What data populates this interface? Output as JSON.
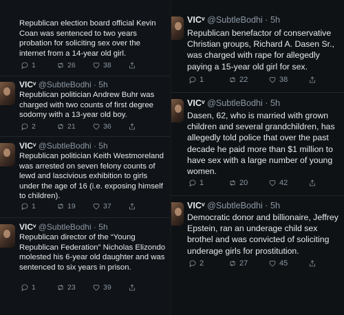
{
  "left": [
    {
      "author": "",
      "handle": "",
      "text": "Republican election board official Kevin Coan was sentenced to two years probation for soliciting sex over the internet from a 14-year old girl.",
      "replies": "1",
      "retweets": "26",
      "likes": "38"
    },
    {
      "author": "VICᵛ",
      "handle": "@SubtleBodhi · 5h",
      "text": "Republican politician Andrew Buhr was charged with two counts of first degree sodomy with a 13-year old boy.",
      "replies": "2",
      "retweets": "21",
      "likes": "36"
    },
    {
      "author": "VICᵛ",
      "handle": "@SubtleBodhi · 5h",
      "text": "Republican politician Keith Westmoreland was arrested on seven felony counts of lewd and lascivious exhibition to girls under the age of 16 (i.e. exposing himself to children).",
      "replies": "1",
      "retweets": "19",
      "likes": "37"
    },
    {
      "author": "VICᵛ",
      "handle": "@SubtleBodhi · 5h",
      "text": "Republican director of the “Young Republican Federation” Nicholas Elizondo molested his 6-year old daughter and was sentenced to six years in prison.",
      "replies": "1",
      "retweets": "23",
      "likes": "39"
    }
  ],
  "right": [
    {
      "author": "VICᵛ",
      "handle": "@SubtleBodhi · 5h",
      "text": "Republican benefactor of conservative Christian groups, Richard A. Dasen Sr., was charged with rape for allegedly paying a 15-year old girl for sex.",
      "replies": "1",
      "retweets": "22",
      "likes": "38"
    },
    {
      "author": "VICᵛ",
      "handle": "@SubtleBodhi · 5h",
      "text": "Dasen, 62, who is married with grown children and several grandchildren, has allegedly told police that over the past decade he paid more than $1 million to have sex with a large number of young women.",
      "replies": "1",
      "retweets": "20",
      "likes": "42"
    },
    {
      "author": "VICᵛ",
      "handle": "@SubtleBodhi · 5h",
      "text": "Democratic donor and billionaire, Jeffrey Epstein, ran an underage child sex brothel and was convicted of soliciting underage girls for prostitution.",
      "replies": "2",
      "retweets": "27",
      "likes": "45"
    }
  ],
  "icons": [
    "reply-icon",
    "retweet-icon",
    "like-icon",
    "share-icon"
  ],
  "colors": {
    "text": "#e7e9ea",
    "muted": "#8b98a5",
    "background": "#101317"
  }
}
